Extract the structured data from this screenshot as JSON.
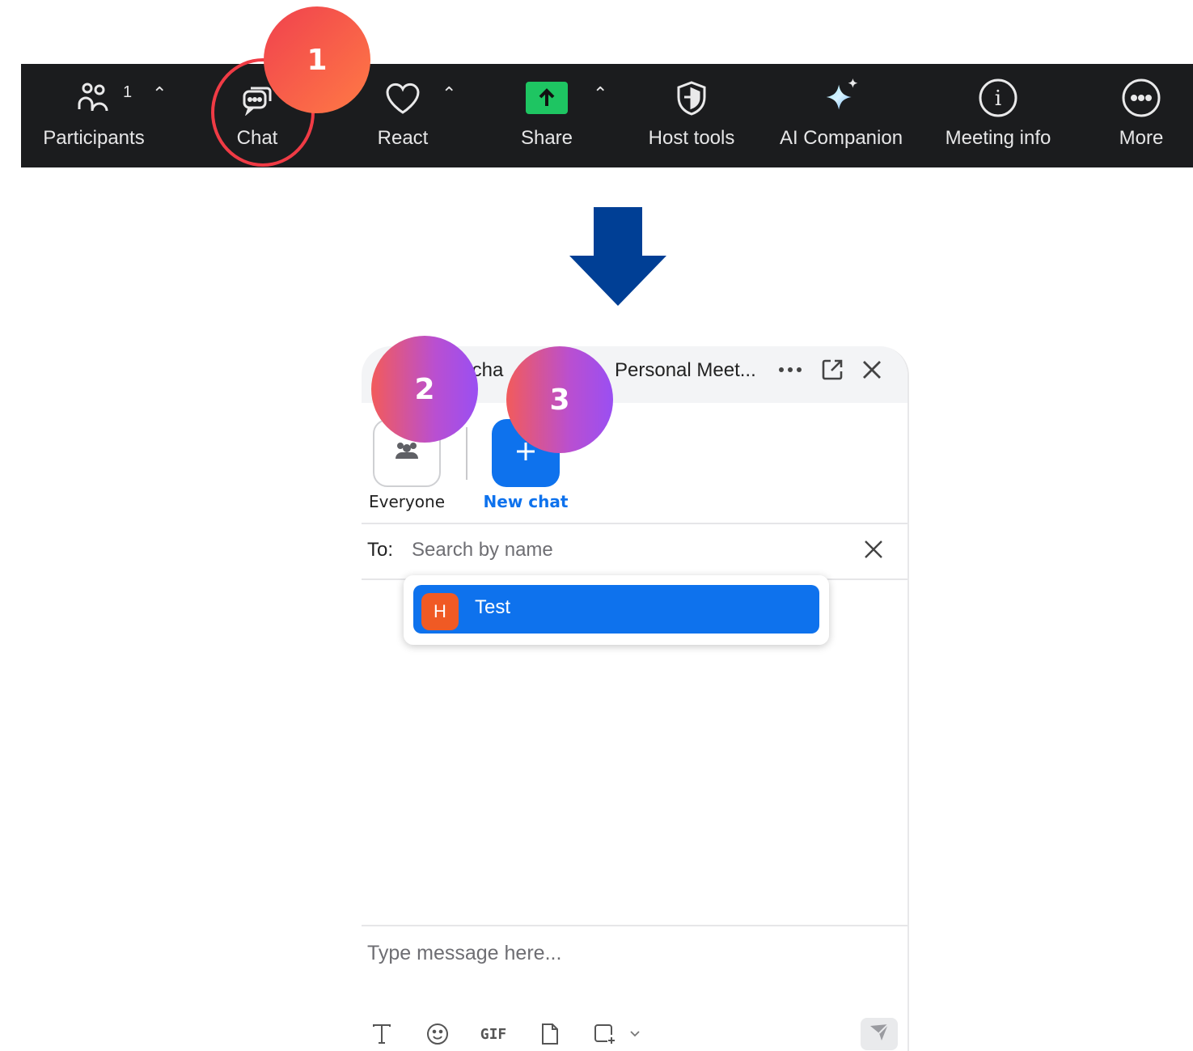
{
  "toolbar": {
    "participants": {
      "label": "Participants",
      "count": "1"
    },
    "chat": {
      "label": "Chat"
    },
    "react": {
      "label": "React"
    },
    "share": {
      "label": "Share"
    },
    "host_tools": {
      "label": "Host tools"
    },
    "ai_companion": {
      "label": "AI Companion"
    },
    "meeting_info": {
      "label": "Meeting info"
    },
    "more": {
      "label": "More"
    }
  },
  "steps": [
    "1",
    "2",
    "3"
  ],
  "chat_panel": {
    "title": "Personal Meet...",
    "title_fragment": "tcha",
    "recipients": {
      "everyone_label": "Everyone",
      "new_chat_label": "New chat"
    },
    "to_label": "To:",
    "search_placeholder": "Search by name",
    "suggestion": {
      "avatar_initial": "H",
      "name": "Test"
    },
    "message_placeholder": "Type message here...",
    "tools": {
      "gif_label": "GIF"
    }
  },
  "colors": {
    "toolbar_bg": "#1b1c1e",
    "share_green": "#1ec562",
    "accent_blue": "#0e72ed",
    "avatar_orange": "#f05a24",
    "highlight_red": "#f03b45",
    "arrow_navy": "#003f95"
  }
}
